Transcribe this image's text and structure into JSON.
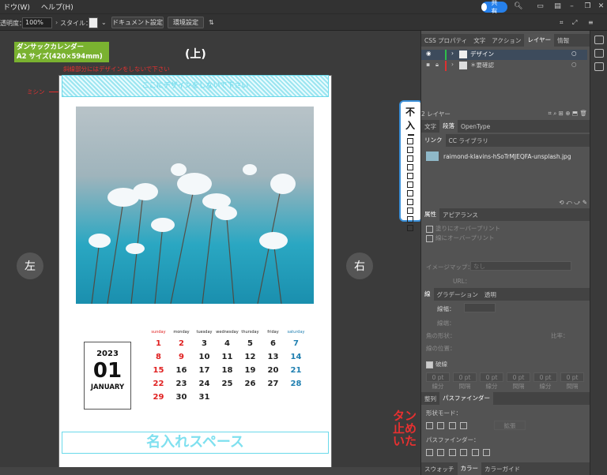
{
  "menu": {
    "window": "ドウ(W)",
    "help": "ヘルプ(H)"
  },
  "topbar": {
    "share_label": "共有"
  },
  "control": {
    "opacity_label": "透明度：",
    "opacity_value": "100%",
    "style_label": "スタイル：",
    "doc_settings": "ドキュメント設定",
    "prefs": "環境設定"
  },
  "canvas": {
    "tag_line1": "ダンサックカレンダー",
    "tag_line2": "A2 サイズ(420×594mm)",
    "top_mark": "(上)",
    "warning": "斜線部分にはデザインをしないで下さい",
    "perf_label": "ミシン",
    "hatch_text": "ここにデザインをしないで下さい",
    "left_btn": "左",
    "right_btn": "右",
    "year": "2023",
    "month_num": "01",
    "month_name": "JANUARY",
    "calendar": {
      "days": [
        "sunday",
        "monday",
        "tuesday",
        "wednesday",
        "thursday",
        "friday",
        "saturday"
      ],
      "rows": [
        [
          "1",
          "2",
          "3",
          "4",
          "5",
          "6",
          "7"
        ],
        [
          "8",
          "9",
          "10",
          "11",
          "12",
          "13",
          "14"
        ],
        [
          "15",
          "16",
          "17",
          "18",
          "19",
          "20",
          "21"
        ],
        [
          "22",
          "23",
          "24",
          "25",
          "26",
          "27",
          "28"
        ],
        [
          "29",
          "30",
          "31",
          "",
          "",
          "",
          ""
        ]
      ]
    },
    "name_space": "名入れスペース",
    "right_box_a": "不",
    "right_box_b": "入",
    "red_side": [
      "タン",
      "止め",
      "いた"
    ]
  },
  "panels": {
    "tabs1": [
      "CSS プロパティ",
      "文字",
      "アクション",
      "レイヤー",
      "情報"
    ],
    "active_tab1": "レイヤー",
    "layers": [
      "デザイン",
      "＊要確認"
    ],
    "layer_count": "2 レイヤー",
    "tabs2": [
      "文字",
      "段落",
      "OpenType"
    ],
    "tabs3": [
      "リンク",
      "CC ライブラリ"
    ],
    "link_file": "raimond-klavins-hSoTrMJEQFA-unsplash.jpg",
    "tabs4": [
      "属性",
      "アピアランス"
    ],
    "overprint_fill": "塗りにオーバープリント",
    "overprint_stroke": "線にオーバープリント",
    "imagemap": "イメージマップ：",
    "imagemap_val": "なし",
    "url": "URL：",
    "tabs5": [
      "線",
      "グラデーション",
      "透明"
    ],
    "stroke_weight": "線幅：",
    "cap": "線端：",
    "corner": "角の形状：",
    "align": "線の位置：",
    "ratio": "比率：",
    "dashed": "破線",
    "dash_cells": [
      "線分",
      "間隔",
      "線分",
      "間隔",
      "線分",
      "間隔"
    ],
    "dash_value": "0 pt",
    "tabs6": [
      "整列",
      "パスファインダー"
    ],
    "shape_mode": "形状モード：",
    "expand": "拡張",
    "pathfinder": "パスファインダー：",
    "tabs7": [
      "スウォッチ",
      "カラー",
      "カラーガイド"
    ]
  }
}
